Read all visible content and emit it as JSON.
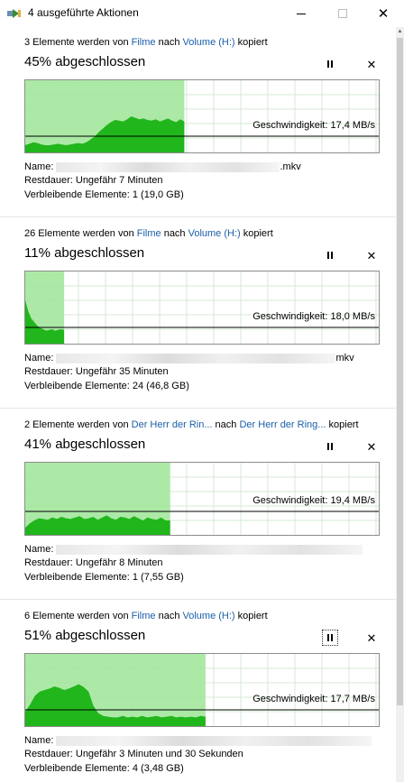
{
  "window": {
    "title": "4 ausgeführte Aktionen",
    "minimize_glyph": "",
    "maximize_glyph": "",
    "close_glyph": "✕"
  },
  "labels": {
    "name": "Name:",
    "remaining_time": "Restdauer:",
    "remaining_items": "Verbleibende Elemente:",
    "speed_prefix": "Geschwindigkeit:"
  },
  "colors": {
    "graph_fill": "#9de598",
    "graph_line": "#21b61c",
    "grid": "#d6e8d6",
    "link": "#1a5fa8"
  },
  "operations": [
    {
      "desc_pre": "3 Elemente werden von ",
      "source": "Filme",
      "desc_mid": " nach ",
      "dest": "Volume (H:)",
      "desc_post": " kopiert",
      "percent_text": "45% abgeschlossen",
      "progress": 0.45,
      "speed": "17,4 MB/s",
      "name_suffix": ".mkv",
      "remaining_time": "Ungefähr 7 Minuten",
      "remaining_items": "1 (19,0 GB)",
      "history": [
        0.1,
        0.12,
        0.14,
        0.13,
        0.11,
        0.1,
        0.1,
        0.11,
        0.12,
        0.11,
        0.1,
        0.11,
        0.12,
        0.13,
        0.12,
        0.14,
        0.18,
        0.22,
        0.28,
        0.33,
        0.38,
        0.42,
        0.45,
        0.44,
        0.43,
        0.46,
        0.5,
        0.48,
        0.46,
        0.47,
        0.45,
        0.44,
        0.46,
        0.43,
        0.45,
        0.47,
        0.44,
        0.42,
        0.46,
        0.43
      ],
      "speed_level": 0.22
    },
    {
      "desc_pre": "26 Elemente werden von ",
      "source": "Filme",
      "desc_mid": " nach ",
      "dest": "Volume (H:)",
      "desc_post": " kopiert",
      "percent_text": "11% abgeschlossen",
      "progress": 0.11,
      "speed": "18,0 MB/s",
      "name_suffix": "mkv",
      "remaining_time": "Ungefähr 35 Minuten",
      "remaining_items": "24 (46,8 GB)",
      "history": [
        0.6,
        0.45,
        0.35,
        0.3,
        0.25,
        0.22,
        0.2,
        0.18,
        0.19,
        0.2,
        0.18,
        0.19,
        0.2,
        0.19
      ],
      "speed_level": 0.22
    },
    {
      "desc_pre": "2 Elemente werden von ",
      "source": "Der Herr der Rin...",
      "desc_mid": " nach ",
      "dest": "Der Herr der Ring...",
      "desc_post": " kopiert",
      "percent_text": "41% abgeschlossen",
      "progress": 0.41,
      "speed": "19,4 MB/s",
      "name_suffix": "",
      "remaining_time": "Ungefähr 8 Minuten",
      "remaining_items": "1 (7,55 GB)",
      "history": [
        0.1,
        0.16,
        0.2,
        0.23,
        0.22,
        0.21,
        0.24,
        0.22,
        0.25,
        0.23,
        0.22,
        0.24,
        0.26,
        0.22,
        0.23,
        0.25,
        0.21,
        0.24,
        0.27,
        0.23,
        0.21,
        0.25,
        0.24,
        0.22,
        0.26,
        0.23,
        0.2,
        0.24,
        0.22,
        0.21,
        0.24,
        0.2,
        0.2
      ],
      "speed_level": 0.32
    },
    {
      "desc_pre": "6 Elemente werden von ",
      "source": "Filme",
      "desc_mid": " nach ",
      "dest": "Volume (H:)",
      "desc_post": " kopiert",
      "percent_text": "51% abgeschlossen",
      "progress": 0.51,
      "speed": "17,7 MB/s",
      "name_suffix": "",
      "remaining_time": "Ungefähr 3 Minuten und 30 Sekunden",
      "remaining_items": "4 (3,48 GB)",
      "history": [
        0.2,
        0.3,
        0.42,
        0.48,
        0.5,
        0.52,
        0.55,
        0.53,
        0.5,
        0.52,
        0.55,
        0.58,
        0.54,
        0.48,
        0.28,
        0.18,
        0.14,
        0.13,
        0.12,
        0.12,
        0.14,
        0.12,
        0.13,
        0.12,
        0.14,
        0.12,
        0.13,
        0.14,
        0.12,
        0.13,
        0.14,
        0.12,
        0.13,
        0.12,
        0.13,
        0.12,
        0.14,
        0.13
      ],
      "speed_level": 0.22
    }
  ]
}
